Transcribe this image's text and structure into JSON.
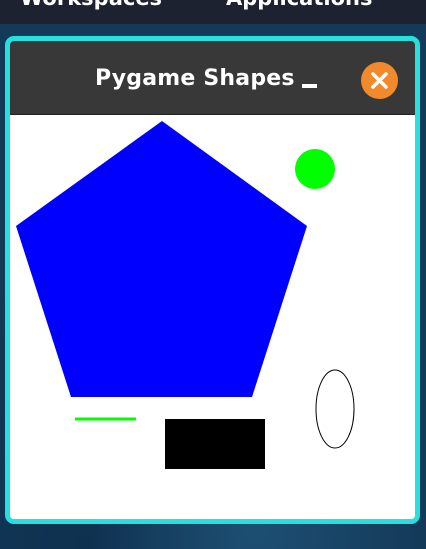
{
  "top_bar": {
    "workspaces_label": "Workspaces",
    "applications_label": "Applications"
  },
  "window": {
    "title": "Pygame Shapes",
    "border_color": "#26e0e0",
    "titlebar_color": "#383838",
    "close_button_color": "#f08a2c",
    "minimize_icon": "minimize-icon",
    "close_icon": "close-icon"
  },
  "canvas": {
    "background": "#ffffff",
    "shapes": [
      {
        "kind": "polygon",
        "description": "pentagon",
        "fill": "#0000ff"
      },
      {
        "kind": "circle",
        "fill": "#00ff00"
      },
      {
        "kind": "line",
        "stroke": "#00ff00"
      },
      {
        "kind": "rectangle",
        "fill": "#000000"
      },
      {
        "kind": "ellipse",
        "stroke": "#000000",
        "fill": "none"
      }
    ]
  }
}
